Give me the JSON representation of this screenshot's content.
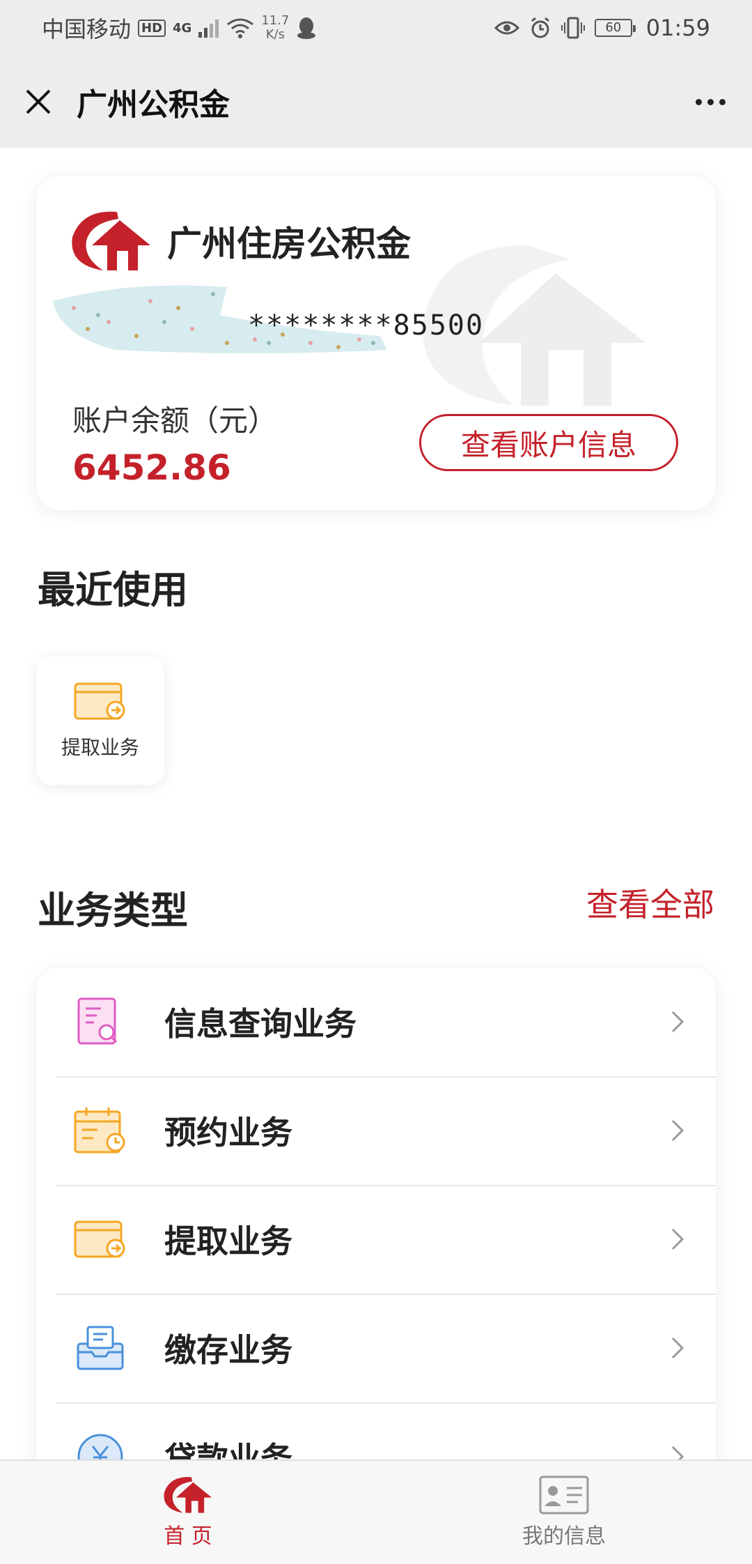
{
  "status_bar": {
    "carrier": "中国移动",
    "hd_badge": "HD",
    "network": "4G",
    "speed_value": "11.7",
    "speed_unit": "K/s",
    "battery": "60",
    "time": "01:59"
  },
  "nav": {
    "title": "广州公积金"
  },
  "account": {
    "brand_name": "广州住房公积金",
    "masked_number": "********85500",
    "balance_label": "账户余额（元）",
    "balance_value": "6452.86",
    "view_account_label": "查看账户信息"
  },
  "recent": {
    "title": "最近使用",
    "items": [
      {
        "label": "提取业务",
        "icon": "withdraw-icon"
      }
    ]
  },
  "business": {
    "title": "业务类型",
    "view_all": "查看全部",
    "items": [
      {
        "label": "信息查询业务",
        "icon": "info-query-icon"
      },
      {
        "label": "预约业务",
        "icon": "appointment-icon"
      },
      {
        "label": "提取业务",
        "icon": "withdraw-icon"
      },
      {
        "label": "缴存业务",
        "icon": "deposit-icon"
      },
      {
        "label": "贷款业务",
        "icon": "loan-icon"
      }
    ]
  },
  "tabs": [
    {
      "label": "首 页",
      "active": true
    },
    {
      "label": "我的信息",
      "active": false
    }
  ],
  "colors": {
    "brand_red": "#c4212a",
    "icon_orange": "#f5a623",
    "icon_pink": "#e05cc3",
    "icon_blue": "#4a90d9"
  }
}
